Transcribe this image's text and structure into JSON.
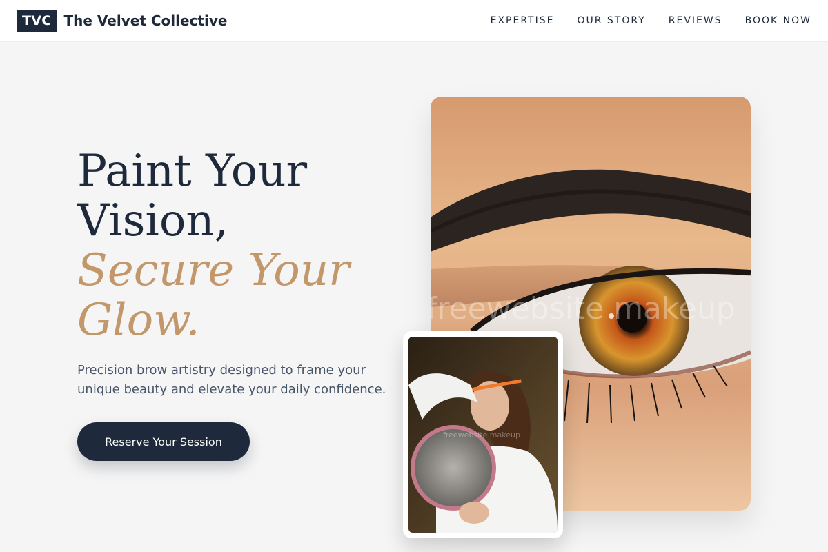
{
  "brand": {
    "logo": "TVC",
    "name": "The Velvet Collective"
  },
  "nav": {
    "items": [
      {
        "label": "EXPERTISE"
      },
      {
        "label": "OUR STORY"
      },
      {
        "label": "REVIEWS"
      },
      {
        "label": "BOOK NOW"
      }
    ]
  },
  "hero": {
    "title_line1": "Paint Your",
    "title_line2": "Vision,",
    "title_accent_line1": "Secure Your",
    "title_accent_line2": "Glow.",
    "subtitle": "Precision brow artistry designed to frame your unique beauty and elevate your daily confidence.",
    "cta_label": "Reserve Your Session"
  },
  "images": {
    "main_watermark": "freewebsite makeup",
    "inset_watermark": "freewebsite makeup"
  },
  "colors": {
    "primary": "#1e293b",
    "accent": "#c2986b",
    "background": "#f5f5f5",
    "text_muted": "#475569"
  }
}
